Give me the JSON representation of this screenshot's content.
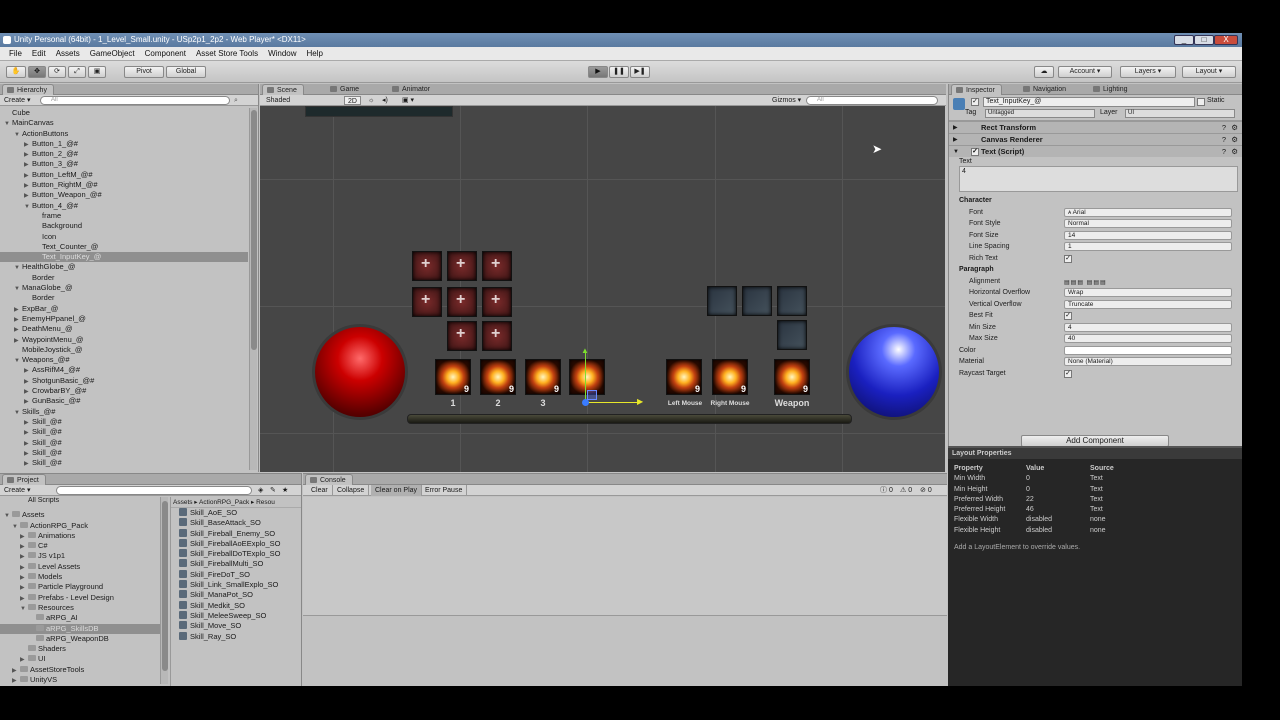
{
  "window": {
    "title": "Unity Personal (64bit) - 1_Level_Small.unity - USp2p1_2p2 - Web Player* <DX11>",
    "minimize": "_",
    "maximize": "□",
    "close": "X"
  },
  "menu": [
    "File",
    "Edit",
    "Assets",
    "GameObject",
    "Component",
    "Asset Store Tools",
    "Window",
    "Help"
  ],
  "toolbar": {
    "pivot": "Pivot",
    "global": "Global",
    "account": "Account",
    "layers": "Layers",
    "layout": "Layout",
    "play_icon": "play-icon",
    "pause_icon": "pause-icon",
    "step_icon": "step-icon"
  },
  "hierarchy": {
    "tab": "Hierarchy",
    "create": "Create",
    "search": "All",
    "items": [
      {
        "label": "Cube",
        "depth": 0,
        "arrow": ""
      },
      {
        "label": "MainCanvas",
        "depth": 0,
        "arrow": "▼"
      },
      {
        "label": "ActionButtons",
        "depth": 1,
        "arrow": "▼"
      },
      {
        "label": "Button_1_@#",
        "depth": 2,
        "arrow": "▶"
      },
      {
        "label": "Button_2_@#",
        "depth": 2,
        "arrow": "▶"
      },
      {
        "label": "Button_3_@#",
        "depth": 2,
        "arrow": "▶"
      },
      {
        "label": "Button_LeftM_@#",
        "depth": 2,
        "arrow": "▶"
      },
      {
        "label": "Button_RightM_@#",
        "depth": 2,
        "arrow": "▶"
      },
      {
        "label": "Button_Weapon_@#",
        "depth": 2,
        "arrow": "▶"
      },
      {
        "label": "Button_4_@#",
        "depth": 2,
        "arrow": "▼"
      },
      {
        "label": "frame",
        "depth": 3,
        "arrow": ""
      },
      {
        "label": "Background",
        "depth": 3,
        "arrow": ""
      },
      {
        "label": "Icon",
        "depth": 3,
        "arrow": ""
      },
      {
        "label": "Text_Counter_@",
        "depth": 3,
        "arrow": ""
      },
      {
        "label": "Text_InputKey_@",
        "depth": 3,
        "arrow": "",
        "selected": true
      },
      {
        "label": "HealthGlobe_@",
        "depth": 1,
        "arrow": "▼"
      },
      {
        "label": "Border",
        "depth": 2,
        "arrow": ""
      },
      {
        "label": "ManaGlobe_@",
        "depth": 1,
        "arrow": "▼"
      },
      {
        "label": "Border",
        "depth": 2,
        "arrow": ""
      },
      {
        "label": "ExpBar_@",
        "depth": 1,
        "arrow": "▶"
      },
      {
        "label": "EnemyHPpanel_@",
        "depth": 1,
        "arrow": "▶"
      },
      {
        "label": "DeathMenu_@",
        "depth": 1,
        "arrow": "▶"
      },
      {
        "label": "WaypointMenu_@",
        "depth": 1,
        "arrow": "▶"
      },
      {
        "label": "MobileJoystick_@",
        "depth": 1,
        "arrow": ""
      },
      {
        "label": "Weapons_@#",
        "depth": 1,
        "arrow": "▼"
      },
      {
        "label": "AssRifM4_@#",
        "depth": 2,
        "arrow": "▶"
      },
      {
        "label": "ShotgunBasic_@#",
        "depth": 2,
        "arrow": "▶"
      },
      {
        "label": "CrowbarBY_@#",
        "depth": 2,
        "arrow": "▶"
      },
      {
        "label": "GunBasic_@#",
        "depth": 2,
        "arrow": "▶"
      },
      {
        "label": "Skills_@#",
        "depth": 1,
        "arrow": "▼"
      },
      {
        "label": "Skill_@#",
        "depth": 2,
        "arrow": "▶"
      },
      {
        "label": "Skill_@#",
        "depth": 2,
        "arrow": "▶"
      },
      {
        "label": "Skill_@#",
        "depth": 2,
        "arrow": "▶"
      },
      {
        "label": "Skill_@#",
        "depth": 2,
        "arrow": "▶"
      },
      {
        "label": "Skill_@#",
        "depth": 2,
        "arrow": "▶"
      }
    ]
  },
  "scene": {
    "tabs": [
      "Scene",
      "Game",
      "Animator"
    ],
    "shaded": "Shaded",
    "mode": "2D",
    "gizmos": "Gizmos",
    "search": "All",
    "slot_labels": [
      "1",
      "2",
      "3",
      "Left Mouse",
      "Right Mouse",
      "Weapon"
    ],
    "stack_count": "9"
  },
  "project": {
    "tab": "Project",
    "create": "Create",
    "favorite": "All Scripts",
    "root": "Assets",
    "folders": [
      {
        "label": "Assets",
        "depth": 0,
        "arrow": "▼"
      },
      {
        "label": "ActionRPG_Pack",
        "depth": 1,
        "arrow": "▼"
      },
      {
        "label": "Animations",
        "depth": 2,
        "arrow": "▶"
      },
      {
        "label": "C#",
        "depth": 2,
        "arrow": "▶"
      },
      {
        "label": "JS v1p1",
        "depth": 2,
        "arrow": "▶"
      },
      {
        "label": "Level Assets",
        "depth": 2,
        "arrow": "▶"
      },
      {
        "label": "Models",
        "depth": 2,
        "arrow": "▶"
      },
      {
        "label": "Particle Playground",
        "depth": 2,
        "arrow": "▶"
      },
      {
        "label": "Prefabs - Level Design",
        "depth": 2,
        "arrow": "▶"
      },
      {
        "label": "Resources",
        "depth": 2,
        "arrow": "▼"
      },
      {
        "label": "aRPG_AI",
        "depth": 3,
        "arrow": ""
      },
      {
        "label": "aRPG_SkillsDB",
        "depth": 3,
        "arrow": "",
        "selected": true
      },
      {
        "label": "aRPG_WeaponDB",
        "depth": 3,
        "arrow": ""
      },
      {
        "label": "Shaders",
        "depth": 2,
        "arrow": ""
      },
      {
        "label": "UI",
        "depth": 2,
        "arrow": "▶"
      },
      {
        "label": "AssetStoreTools",
        "depth": 1,
        "arrow": "▶"
      },
      {
        "label": "UnityVS",
        "depth": 1,
        "arrow": "▶"
      }
    ],
    "breadcrumb": "Assets ▸ ActionRPG_Pack ▸ Resou",
    "files": [
      "Skill_AoE_SO",
      "Skill_BaseAttack_SO",
      "Skill_Fireball_Enemy_SO",
      "Skill_FireballAoEExplo_SO",
      "Skill_FireballDoTExplo_SO",
      "Skill_FireballMulti_SO",
      "Skill_FireDoT_SO",
      "Skill_Link_SmallExplo_SO",
      "Skill_ManaPot_SO",
      "Skill_Medkit_SO",
      "Skill_MeleeSweep_SO",
      "Skill_Move_SO",
      "Skill_Ray_SO"
    ]
  },
  "console": {
    "tab": "Console",
    "buttons": [
      "Clear",
      "Collapse",
      "Clear on Play",
      "Error Pause"
    ],
    "counts": [
      "0",
      "0",
      "0"
    ]
  },
  "inspector": {
    "tabs": [
      "Inspector",
      "Navigation",
      "Lighting"
    ],
    "object_name": "Text_InputKey_@",
    "static": "Static",
    "tag_label": "Tag",
    "tag": "Untagged",
    "layer_label": "Layer",
    "layer": "UI",
    "components": [
      "Rect Transform",
      "Canvas Renderer",
      "Text (Script)"
    ],
    "text_label": "Text",
    "text_value": "4",
    "character_header": "Character",
    "paragraph_header": "Paragraph",
    "fields": {
      "font": "Font",
      "font_v": "Arial",
      "font_style": "Font Style",
      "font_style_v": "Normal",
      "font_size": "Font Size",
      "font_size_v": "14",
      "line_spacing": "Line Spacing",
      "line_spacing_v": "1",
      "rich_text": "Rich Text",
      "alignment": "Alignment",
      "h_overflow": "Horizontal Overflow",
      "h_overflow_v": "Wrap",
      "v_overflow": "Vertical Overflow",
      "v_overflow_v": "Truncate",
      "best_fit": "Best Fit",
      "min_size": "Min Size",
      "min_size_v": "4",
      "max_size": "Max Size",
      "max_size_v": "40",
      "color": "Color",
      "material": "Material",
      "material_v": "None (Material)",
      "raycast": "Raycast Target"
    },
    "add_component": "Add Component"
  },
  "layout_props": {
    "title": "Layout Properties",
    "headers": [
      "Property",
      "Value",
      "Source"
    ],
    "rows": [
      [
        "Min Width",
        "0",
        "Text"
      ],
      [
        "Min Height",
        "0",
        "Text"
      ],
      [
        "Preferred Width",
        "22",
        "Text"
      ],
      [
        "Preferred Height",
        "46",
        "Text"
      ],
      [
        "Flexible Width",
        "disabled",
        "none"
      ],
      [
        "Flexible Height",
        "disabled",
        "none"
      ]
    ],
    "note": "Add a LayoutElement to override values."
  }
}
